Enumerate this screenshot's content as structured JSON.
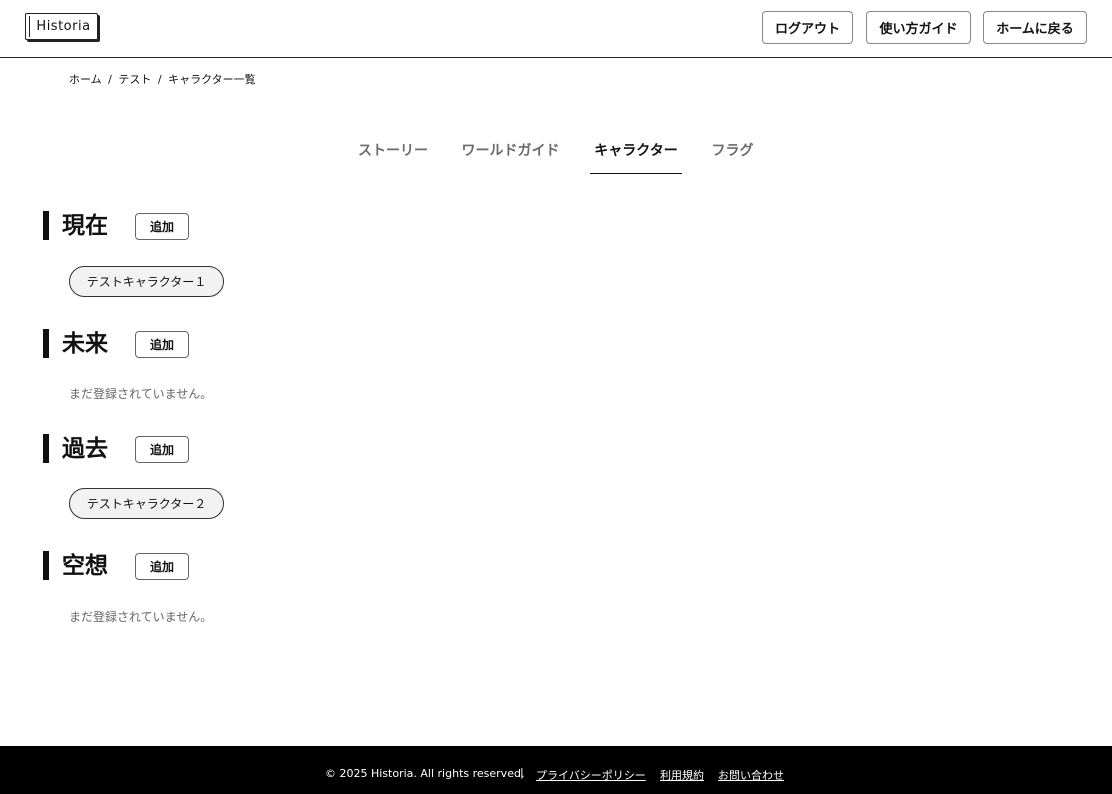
{
  "header": {
    "logo_text": "Historia",
    "logout_label": "ログアウト",
    "guide_label": "使い方ガイド",
    "home_label": "ホームに戻る"
  },
  "breadcrumb": {
    "items": [
      "ホーム",
      "テスト",
      "キャラクター一覧"
    ],
    "separator": "/"
  },
  "tabs": [
    {
      "label": "ストーリー",
      "active": false
    },
    {
      "label": "ワールドガイド",
      "active": false
    },
    {
      "label": "キャラクター",
      "active": true
    },
    {
      "label": "フラグ",
      "active": false
    }
  ],
  "sections": [
    {
      "title": "現在",
      "add_label": "追加",
      "characters": [
        "テストキャラクター１"
      ],
      "empty_text": ""
    },
    {
      "title": "未来",
      "add_label": "追加",
      "characters": [],
      "empty_text": "まだ登録されていません。"
    },
    {
      "title": "過去",
      "add_label": "追加",
      "characters": [
        "テストキャラクター２"
      ],
      "empty_text": ""
    },
    {
      "title": "空想",
      "add_label": "追加",
      "characters": [],
      "empty_text": "まだ登録されていません。"
    }
  ],
  "footer": {
    "copyright": "© 2025 Historia. All rights reserved.",
    "divider": "|",
    "links": [
      "プライバシーポリシー",
      "利用規約",
      "お問い合わせ"
    ]
  },
  "colors": {
    "text": "#111111",
    "muted": "#6b6b6b",
    "footer_bg": "#000000",
    "chip_bg": "#f2f2f2"
  }
}
